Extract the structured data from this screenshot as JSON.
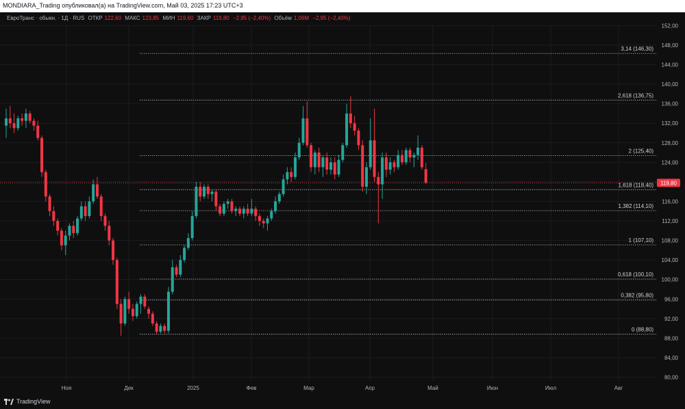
{
  "header": {
    "title": "MONDIARA_Trading опубликовал(а) на TradingView.com, Май 03, 2025 17:23 UTC+3"
  },
  "legend": {
    "symbol": "ЕвроТранс · обыкн. · 1Д · RUS",
    "open_label": "ОТКР",
    "open": "122,60",
    "high_label": "МАКС",
    "high": "123,85",
    "low_label": "МИН",
    "low": "119,60",
    "close_label": "ЗАКР",
    "close": "119,80",
    "change": "−2,95 (−2,40%)",
    "volume_label": "Объём",
    "volume": "1,06M",
    "volume_change": "−2,95 (−2,40%)"
  },
  "footer": {
    "brand": "TradingView"
  },
  "colors": {
    "up": "#26a69a",
    "down": "#f23645",
    "fib_line": "#b2b5be",
    "price_line": "#f23645",
    "background": "#0f0f0f"
  },
  "chart_data": {
    "type": "candlestick",
    "title": "",
    "xlabel": "",
    "ylabel": "",
    "ylim": [
      78,
      154
    ],
    "y_ticks": [
      "80,00",
      "84,00",
      "88,00",
      "92,00",
      "96,00",
      "100,00",
      "104,00",
      "108,00",
      "112,00",
      "116,00",
      "120,00",
      "124,00",
      "128,00",
      "132,00",
      "136,00",
      "140,00",
      "144,00",
      "148,00",
      "152,00"
    ],
    "x_tick_labels": [
      "Ноя",
      "Дек",
      "2025",
      "Фев",
      "Мар",
      "Апр",
      "Май",
      "Июн",
      "Июл",
      "Авг"
    ],
    "last_price": {
      "value": 119.8,
      "label": "119,80"
    },
    "fib_levels": [
      {
        "label": "3,14 (146,30)",
        "value": 146.3
      },
      {
        "label": "2,618 (136,75)",
        "value": 136.75
      },
      {
        "label": "2 (125,40)",
        "value": 125.4
      },
      {
        "label": "1,618 (118,40)",
        "value": 118.4
      },
      {
        "label": "1,382 (114,10)",
        "value": 114.1
      },
      {
        "label": "1 (107,10)",
        "value": 107.1
      },
      {
        "label": "0,618 (100,10)",
        "value": 100.1
      },
      {
        "label": "0,382 (95,80)",
        "value": 95.8
      },
      {
        "label": "0 (88,80)",
        "value": 88.8
      }
    ],
    "candles": [
      {
        "o": 131.5,
        "h": 135.0,
        "l": 129.0,
        "c": 133.0
      },
      {
        "o": 133.0,
        "h": 135.5,
        "l": 131.0,
        "c": 132.0
      },
      {
        "o": 132.0,
        "h": 134.0,
        "l": 130.0,
        "c": 131.0
      },
      {
        "o": 131.0,
        "h": 133.5,
        "l": 130.5,
        "c": 133.0
      },
      {
        "o": 133.0,
        "h": 134.0,
        "l": 131.5,
        "c": 132.5
      },
      {
        "o": 132.5,
        "h": 135.0,
        "l": 131.0,
        "c": 134.0
      },
      {
        "o": 134.0,
        "h": 134.5,
        "l": 132.0,
        "c": 132.5
      },
      {
        "o": 132.5,
        "h": 133.0,
        "l": 130.5,
        "c": 131.5
      },
      {
        "o": 131.5,
        "h": 132.5,
        "l": 128.5,
        "c": 129.0
      },
      {
        "o": 129.0,
        "h": 129.5,
        "l": 121.0,
        "c": 122.0
      },
      {
        "o": 122.0,
        "h": 122.5,
        "l": 116.0,
        "c": 117.0
      },
      {
        "o": 117.0,
        "h": 117.5,
        "l": 113.0,
        "c": 114.0
      },
      {
        "o": 114.0,
        "h": 115.0,
        "l": 111.0,
        "c": 112.0
      },
      {
        "o": 112.0,
        "h": 112.5,
        "l": 109.0,
        "c": 110.0
      },
      {
        "o": 110.0,
        "h": 110.5,
        "l": 106.0,
        "c": 107.0
      },
      {
        "o": 107.0,
        "h": 110.0,
        "l": 105.0,
        "c": 109.0
      },
      {
        "o": 109.0,
        "h": 111.5,
        "l": 108.0,
        "c": 111.0
      },
      {
        "o": 111.0,
        "h": 112.0,
        "l": 108.5,
        "c": 109.5
      },
      {
        "o": 109.5,
        "h": 113.0,
        "l": 109.0,
        "c": 112.5
      },
      {
        "o": 112.5,
        "h": 116.0,
        "l": 112.0,
        "c": 115.0
      },
      {
        "o": 115.0,
        "h": 116.0,
        "l": 112.0,
        "c": 113.0
      },
      {
        "o": 113.0,
        "h": 117.0,
        "l": 112.5,
        "c": 116.0
      },
      {
        "o": 116.0,
        "h": 120.5,
        "l": 115.5,
        "c": 119.5
      },
      {
        "o": 119.5,
        "h": 121.0,
        "l": 116.5,
        "c": 117.0
      },
      {
        "o": 117.0,
        "h": 117.5,
        "l": 112.0,
        "c": 113.0
      },
      {
        "o": 113.0,
        "h": 113.5,
        "l": 110.0,
        "c": 111.0
      },
      {
        "o": 111.0,
        "h": 112.0,
        "l": 107.0,
        "c": 108.0
      },
      {
        "o": 108.0,
        "h": 108.5,
        "l": 103.0,
        "c": 104.0
      },
      {
        "o": 104.0,
        "h": 104.5,
        "l": 94.0,
        "c": 95.0
      },
      {
        "o": 95.0,
        "h": 96.0,
        "l": 88.5,
        "c": 91.0
      },
      {
        "o": 91.0,
        "h": 96.5,
        "l": 90.5,
        "c": 96.0
      },
      {
        "o": 96.0,
        "h": 97.5,
        "l": 93.0,
        "c": 94.0
      },
      {
        "o": 94.0,
        "h": 95.0,
        "l": 91.5,
        "c": 92.5
      },
      {
        "o": 92.5,
        "h": 95.5,
        "l": 92.0,
        "c": 95.0
      },
      {
        "o": 95.0,
        "h": 97.0,
        "l": 93.0,
        "c": 96.5
      },
      {
        "o": 96.5,
        "h": 97.0,
        "l": 94.0,
        "c": 94.5
      },
      {
        "o": 94.0,
        "h": 94.5,
        "l": 92.0,
        "c": 93.0
      },
      {
        "o": 93.0,
        "h": 93.5,
        "l": 90.5,
        "c": 91.0
      },
      {
        "o": 91.0,
        "h": 91.5,
        "l": 88.8,
        "c": 89.3
      },
      {
        "o": 89.3,
        "h": 91.0,
        "l": 89.0,
        "c": 90.5
      },
      {
        "o": 90.5,
        "h": 91.0,
        "l": 89.0,
        "c": 89.5
      },
      {
        "o": 89.5,
        "h": 98.5,
        "l": 89.0,
        "c": 97.5
      },
      {
        "o": 97.5,
        "h": 104.0,
        "l": 97.0,
        "c": 102.5
      },
      {
        "o": 102.5,
        "h": 103.0,
        "l": 100.5,
        "c": 101.0
      },
      {
        "o": 101.0,
        "h": 105.0,
        "l": 100.5,
        "c": 104.0
      },
      {
        "o": 104.0,
        "h": 107.0,
        "l": 103.5,
        "c": 106.5
      },
      {
        "o": 106.5,
        "h": 109.5,
        "l": 106.0,
        "c": 108.5
      },
      {
        "o": 108.5,
        "h": 114.0,
        "l": 108.0,
        "c": 113.0
      },
      {
        "o": 113.0,
        "h": 120.0,
        "l": 112.5,
        "c": 119.0
      },
      {
        "o": 119.0,
        "h": 120.0,
        "l": 116.0,
        "c": 117.0
      },
      {
        "o": 117.0,
        "h": 119.5,
        "l": 116.5,
        "c": 119.0
      },
      {
        "o": 119.0,
        "h": 119.5,
        "l": 116.5,
        "c": 117.5
      },
      {
        "o": 117.5,
        "h": 118.5,
        "l": 116.0,
        "c": 118.0
      },
      {
        "o": 118.0,
        "h": 118.5,
        "l": 114.0,
        "c": 115.0
      },
      {
        "o": 115.0,
        "h": 115.5,
        "l": 113.0,
        "c": 113.5
      },
      {
        "o": 113.5,
        "h": 116.0,
        "l": 113.0,
        "c": 115.5
      },
      {
        "o": 115.5,
        "h": 116.5,
        "l": 114.5,
        "c": 116.0
      },
      {
        "o": 116.0,
        "h": 116.5,
        "l": 113.5,
        "c": 114.0
      },
      {
        "o": 114.0,
        "h": 115.0,
        "l": 113.0,
        "c": 114.5
      },
      {
        "o": 114.5,
        "h": 115.0,
        "l": 113.0,
        "c": 113.5
      },
      {
        "o": 113.5,
        "h": 115.0,
        "l": 112.5,
        "c": 114.5
      },
      {
        "o": 114.5,
        "h": 115.5,
        "l": 113.0,
        "c": 113.5
      },
      {
        "o": 113.5,
        "h": 116.5,
        "l": 113.0,
        "c": 114.5
      },
      {
        "o": 114.5,
        "h": 115.0,
        "l": 112.0,
        "c": 113.0
      },
      {
        "o": 113.0,
        "h": 113.5,
        "l": 111.0,
        "c": 112.0
      },
      {
        "o": 112.0,
        "h": 112.5,
        "l": 110.5,
        "c": 111.5
      },
      {
        "o": 111.5,
        "h": 113.0,
        "l": 110.0,
        "c": 112.5
      },
      {
        "o": 112.5,
        "h": 114.5,
        "l": 112.0,
        "c": 114.0
      },
      {
        "o": 114.0,
        "h": 117.0,
        "l": 113.5,
        "c": 116.0
      },
      {
        "o": 116.0,
        "h": 118.0,
        "l": 115.5,
        "c": 117.5
      },
      {
        "o": 117.5,
        "h": 121.5,
        "l": 117.0,
        "c": 120.5
      },
      {
        "o": 120.5,
        "h": 123.0,
        "l": 119.5,
        "c": 122.0
      },
      {
        "o": 122.0,
        "h": 123.0,
        "l": 120.0,
        "c": 121.0
      },
      {
        "o": 121.0,
        "h": 126.0,
        "l": 120.5,
        "c": 125.0
      },
      {
        "o": 125.0,
        "h": 129.0,
        "l": 124.5,
        "c": 128.0
      },
      {
        "o": 128.0,
        "h": 135.5,
        "l": 127.5,
        "c": 133.0
      },
      {
        "o": 133.0,
        "h": 136.5,
        "l": 127.0,
        "c": 127.5
      },
      {
        "o": 127.5,
        "h": 128.0,
        "l": 122.0,
        "c": 123.0
      },
      {
        "o": 123.0,
        "h": 126.5,
        "l": 121.5,
        "c": 126.0
      },
      {
        "o": 126.0,
        "h": 127.0,
        "l": 122.0,
        "c": 123.0
      },
      {
        "o": 123.0,
        "h": 125.5,
        "l": 121.0,
        "c": 125.0
      },
      {
        "o": 125.0,
        "h": 126.0,
        "l": 121.5,
        "c": 122.5
      },
      {
        "o": 122.5,
        "h": 125.0,
        "l": 121.5,
        "c": 124.0
      },
      {
        "o": 124.0,
        "h": 125.0,
        "l": 120.5,
        "c": 121.5
      },
      {
        "o": 121.5,
        "h": 125.5,
        "l": 121.0,
        "c": 124.5
      },
      {
        "o": 124.5,
        "h": 128.0,
        "l": 124.0,
        "c": 127.5
      },
      {
        "o": 127.5,
        "h": 136.0,
        "l": 127.0,
        "c": 134.0
      },
      {
        "o": 134.0,
        "h": 137.5,
        "l": 131.0,
        "c": 132.0
      },
      {
        "o": 132.0,
        "h": 133.5,
        "l": 129.5,
        "c": 130.5
      },
      {
        "o": 130.5,
        "h": 131.0,
        "l": 126.5,
        "c": 127.5
      },
      {
        "o": 127.5,
        "h": 128.5,
        "l": 118.0,
        "c": 119.0
      },
      {
        "o": 119.0,
        "h": 124.0,
        "l": 117.5,
        "c": 123.0
      },
      {
        "o": 123.0,
        "h": 133.0,
        "l": 122.5,
        "c": 128.5
      },
      {
        "o": 128.5,
        "h": 135.0,
        "l": 120.0,
        "c": 121.0
      },
      {
        "o": 121.0,
        "h": 122.0,
        "l": 111.5,
        "c": 119.5
      },
      {
        "o": 119.5,
        "h": 126.0,
        "l": 116.5,
        "c": 125.0
      },
      {
        "o": 125.0,
        "h": 126.0,
        "l": 121.0,
        "c": 122.5
      },
      {
        "o": 122.5,
        "h": 125.0,
        "l": 121.5,
        "c": 124.0
      },
      {
        "o": 124.0,
        "h": 124.5,
        "l": 122.0,
        "c": 123.0
      },
      {
        "o": 123.0,
        "h": 126.5,
        "l": 122.5,
        "c": 125.5
      },
      {
        "o": 125.5,
        "h": 126.5,
        "l": 123.5,
        "c": 124.0
      },
      {
        "o": 124.0,
        "h": 127.0,
        "l": 123.5,
        "c": 126.5
      },
      {
        "o": 126.5,
        "h": 127.0,
        "l": 124.0,
        "c": 125.0
      },
      {
        "o": 125.0,
        "h": 126.0,
        "l": 123.0,
        "c": 125.5
      },
      {
        "o": 125.5,
        "h": 129.5,
        "l": 124.5,
        "c": 127.0
      },
      {
        "o": 127.0,
        "h": 127.5,
        "l": 122.5,
        "c": 123.0
      },
      {
        "o": 122.6,
        "h": 123.85,
        "l": 119.6,
        "c": 119.8
      }
    ]
  }
}
